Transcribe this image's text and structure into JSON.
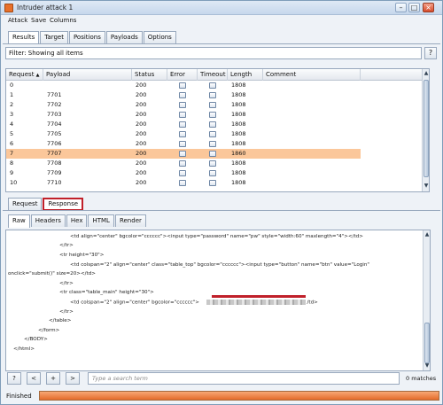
{
  "window": {
    "title": "Intruder attack 1"
  },
  "menu": [
    "Attack",
    "Save",
    "Columns"
  ],
  "main_tabs": [
    "Results",
    "Target",
    "Positions",
    "Payloads",
    "Options"
  ],
  "filter": {
    "text": "Filter: Showing all items",
    "help": "?"
  },
  "table": {
    "columns": [
      "Request",
      "Payload",
      "Status",
      "Error",
      "Timeout",
      "Length",
      "Comment"
    ],
    "sort_indicator": "▲",
    "rows": [
      {
        "request": "0",
        "payload": "",
        "status": "200",
        "length": "1808"
      },
      {
        "request": "1",
        "payload": "7701",
        "status": "200",
        "length": "1808"
      },
      {
        "request": "2",
        "payload": "7702",
        "status": "200",
        "length": "1808"
      },
      {
        "request": "3",
        "payload": "7703",
        "status": "200",
        "length": "1808"
      },
      {
        "request": "4",
        "payload": "7704",
        "status": "200",
        "length": "1808"
      },
      {
        "request": "5",
        "payload": "7705",
        "status": "200",
        "length": "1808"
      },
      {
        "request": "6",
        "payload": "7706",
        "status": "200",
        "length": "1808"
      },
      {
        "request": "7",
        "payload": "7707",
        "status": "200",
        "length": "1860"
      },
      {
        "request": "8",
        "payload": "7708",
        "status": "200",
        "length": "1808"
      },
      {
        "request": "9",
        "payload": "7709",
        "status": "200",
        "length": "1808"
      },
      {
        "request": "10",
        "payload": "7710",
        "status": "200",
        "length": "1808"
      }
    ],
    "selected_index": 7
  },
  "detail_tabs": [
    "Request",
    "Response"
  ],
  "view_tabs": [
    "Raw",
    "Headers",
    "Hex",
    "HTML",
    "Render"
  ],
  "code_lines": {
    "l1_a": "<td align=\"center\" bgcolor=\"cccccc\"><input type=\"password\" name=\"pw\" style=\"width:60\" maxlength=\"4\"></td>",
    "l2": "</tr>",
    "l3": "<tr height=\"30\">",
    "l4": "<td colspan=\"2\" align=\"center\" class=\"table_top\" bgcolor=\"cccccc\"><input type=\"button\" name=\"btn\" value=\"Login\"",
    "l5": "onclick=\"submit()\" size=20></td>",
    "l6": "</tr>",
    "l7": "<tr class=\"table_main\" height=\"30\">",
    "l8_a": "<td colspan=\"2\" align=\"center\" bgcolor=\"cccccc\">",
    "l8_b": "/td>",
    "l9": "</tr>",
    "l10": "</table>",
    "l11": "</form>",
    "l12": "</BODY>",
    "l13": "</html>"
  },
  "search": {
    "buttons": [
      "?",
      "<",
      "+",
      ">"
    ],
    "placeholder": "Type a search term",
    "matches": "0 matches"
  },
  "status": {
    "text": "Finished",
    "progress": 1.0
  },
  "colors": {
    "selected_row": "#fbc79a",
    "progress": "#e46b2a",
    "highlight_border": "#c0202a"
  }
}
